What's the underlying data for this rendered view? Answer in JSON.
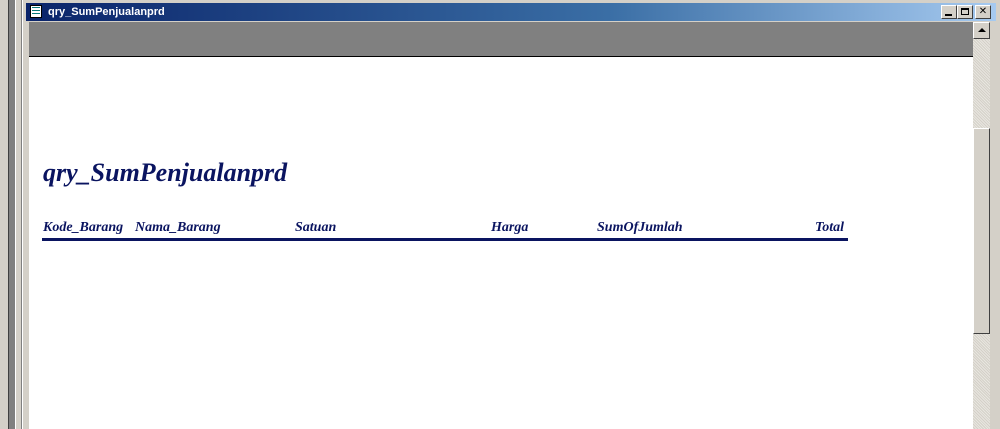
{
  "window": {
    "title": "qry_SumPenjualanprd",
    "icon": "report-icon",
    "controls": {
      "minimize": "minimize-icon",
      "maximize": "maximize-icon",
      "close_label": "✕"
    }
  },
  "report": {
    "title": "qry_SumPenjualanprd",
    "columns": {
      "kode": "Kode_Barang",
      "nama": "Nama_Barang",
      "satuan": "Satuan",
      "harga": "Harga",
      "sum": "SumOfJumlah",
      "total": "Total"
    }
  },
  "colors": {
    "header_text": "#0a1460",
    "titlebar_start": "#0a246a",
    "titlebar_end": "#a6caf0"
  }
}
